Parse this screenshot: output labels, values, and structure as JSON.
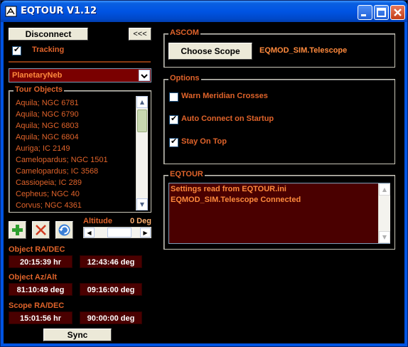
{
  "window": {
    "title": "EQTOUR V1.12"
  },
  "left": {
    "disconnect_label": "Disconnect",
    "collapse_label": "<<<",
    "tracking_label": "Tracking",
    "tracking_checked": true,
    "object_type": "PlanetaryNeb",
    "tour_objects_title": "Tour Objects",
    "tour_objects": [
      "Aquila; NGC 6781",
      "Aquila; NGC 6790",
      "Aquila; NGC 6803",
      "Aquila; NGC 6804",
      "Auriga; IC 2149",
      "Camelopardus; NGC 1501",
      "Camelopardus; IC 3568",
      "Cassiopeia; IC 289",
      "Cepheus; NGC 40",
      "Corvus; NGC 4361"
    ],
    "altitude_label": "Altitude",
    "altitude_value": "0 Deg",
    "altitude_level_percent": 60,
    "object_radec_label": "Object RA/DEC",
    "object_ra": "20:15:39 hr",
    "object_dec": "12:43:46 deg",
    "object_azalt_label": "Object Az/Alt",
    "object_az": "81:10:49 deg",
    "object_alt": "09:16:00 deg",
    "scope_radec_label": "Scope RA/DEC",
    "scope_ra": "15:01:56 hr",
    "scope_dec": "90:00:00 deg",
    "sync_label": "Sync"
  },
  "ascom": {
    "title": "ASCOM",
    "choose_scope_label": "Choose Scope",
    "scope_name": "EQMOD_SIM.Telescope"
  },
  "options": {
    "title": "Options",
    "items": [
      {
        "label": "Warn Meridian Crosses",
        "checked": false
      },
      {
        "label": "Auto Connect on Startup",
        "checked": true
      },
      {
        "label": "Stay On Top",
        "checked": true
      }
    ]
  },
  "eqtour": {
    "title": "EQTOUR",
    "log_line1": "Settings read from EQTOUR.ini",
    "log_line2": "EQMOD_SIM.Telescope Connected"
  },
  "colors": {
    "accent": "#e0632a",
    "panel_bg": "#000000",
    "field_bg": "#4a0000",
    "titlebar": "#0054e3"
  }
}
